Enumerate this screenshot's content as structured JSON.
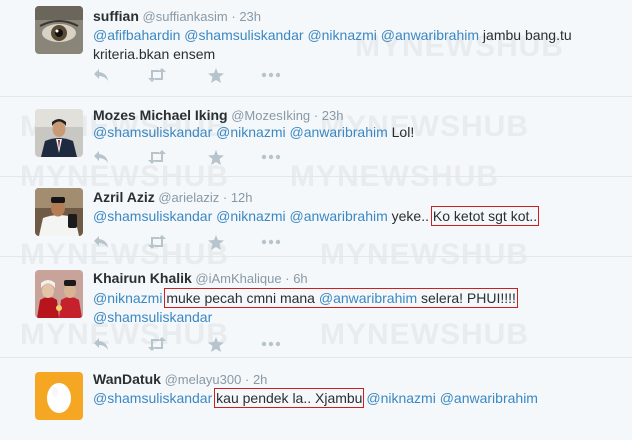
{
  "watermark": "MYNEWSHUB",
  "colors": {
    "mention": "#3b88c3",
    "highlight": "#cc1f1f",
    "meta": "#8899a6",
    "background": "#f5f8fa"
  },
  "tweets": [
    {
      "name": "suffian",
      "handle": "@suffiankasim",
      "sep": "·",
      "time": "23h",
      "parts": [
        {
          "t": "@afifbahardin",
          "m": true
        },
        {
          "t": " "
        },
        {
          "t": "@shamsuliskandar",
          "m": true
        },
        {
          "t": " "
        },
        {
          "t": "@niknazmi",
          "m": true
        },
        {
          "t": " "
        },
        {
          "t": "@anwaribrahim",
          "m": true
        },
        {
          "t": " jambu bang.tu kriteria.bkan ensem"
        }
      ]
    },
    {
      "name": "Mozes Michael Iking",
      "handle": "@MozesIking",
      "sep": "·",
      "time": "23h",
      "parts": [
        {
          "t": "@shamsuliskandar",
          "m": true
        },
        {
          "t": " "
        },
        {
          "t": "@niknazmi",
          "m": true
        },
        {
          "t": " "
        },
        {
          "t": "@anwaribrahim",
          "m": true
        },
        {
          "t": " Lol!"
        }
      ]
    },
    {
      "name": "Azril Aziz",
      "handle": "@arielaziz",
      "sep": "·",
      "time": "12h",
      "parts": [
        {
          "t": "@shamsuliskandar",
          "m": true
        },
        {
          "t": " "
        },
        {
          "t": "@niknazmi",
          "m": true
        },
        {
          "t": " "
        },
        {
          "t": "@anwaribrahim",
          "m": true
        },
        {
          "t": " yeke.. "
        },
        {
          "t": "Ko ketot sgt kot..",
          "h": true
        }
      ]
    },
    {
      "name": "Khairun Khalik",
      "handle": "@iAmKhalique",
      "sep": "·",
      "time": "6h",
      "parts": [
        {
          "t": "@niknazmi",
          "m": true
        },
        {
          "t": " "
        },
        {
          "t": "muke pecah cmni mana @anwaribrahim selera! PHUI!!!!",
          "h": true,
          "mi": [
            21,
            34
          ]
        },
        {
          "t": " "
        },
        {
          "t": "@shamsuliskandar",
          "m": true
        }
      ]
    },
    {
      "name": "WanDatuk",
      "handle": "@melayu300",
      "sep": "·",
      "time": "2h",
      "parts": [
        {
          "t": "@shamsuliskandar",
          "m": true
        },
        {
          "t": " "
        },
        {
          "t": "kau pendek la.. Xjambu",
          "h": true
        },
        {
          "t": " "
        },
        {
          "t": "@niknazmi",
          "m": true
        },
        {
          "t": " "
        },
        {
          "t": "@anwaribrahim",
          "m": true
        }
      ]
    }
  ],
  "actions": [
    "reply-icon",
    "retweet-icon",
    "favorite-icon",
    "more-icon"
  ]
}
